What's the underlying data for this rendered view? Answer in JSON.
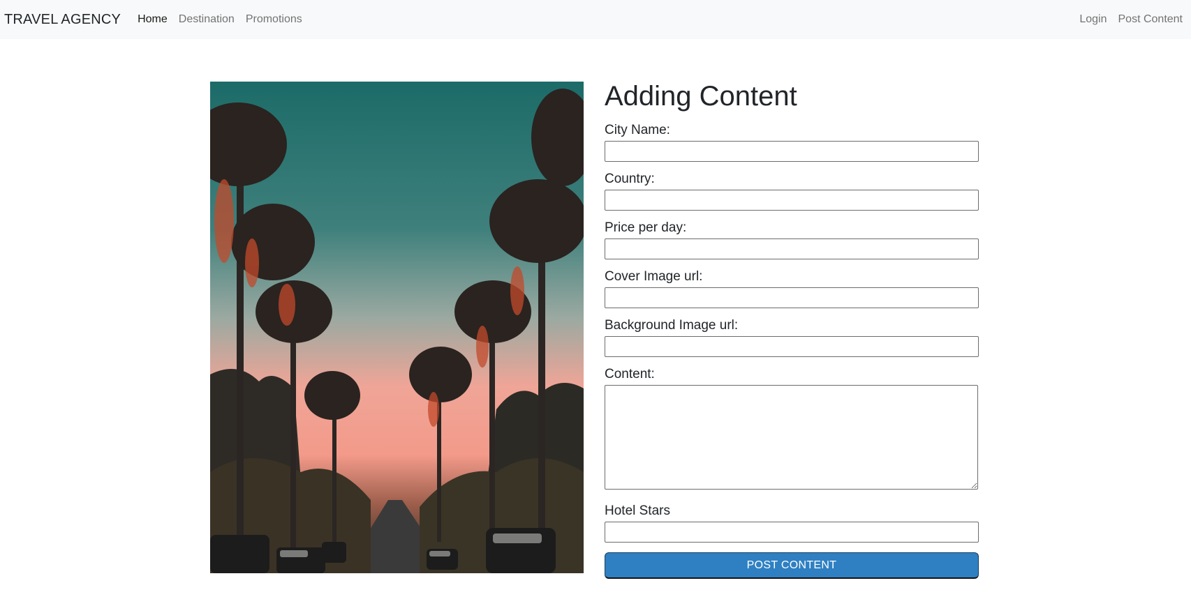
{
  "navbar": {
    "brand": "TRAVEL AGENCY",
    "left_links": [
      "Home",
      "Destination",
      "Promotions"
    ],
    "right_links": [
      "Login",
      "Post Content"
    ],
    "active": "Home"
  },
  "form": {
    "title": "Adding Content",
    "city_label": "City Name:",
    "city_value": "",
    "country_label": "Country:",
    "country_value": "",
    "price_label": "Price per day:",
    "price_value": "",
    "cover_label": "Cover Image url:",
    "cover_value": "",
    "background_label": "Background Image url:",
    "background_value": "",
    "content_label": "Content:",
    "content_value": "",
    "stars_label": "Hotel Stars",
    "stars_value": "",
    "submit_label": "POST CONTENT"
  },
  "colors": {
    "navbar_bg": "#f8f9fa",
    "button": "#2f80c2",
    "text": "#212529"
  }
}
